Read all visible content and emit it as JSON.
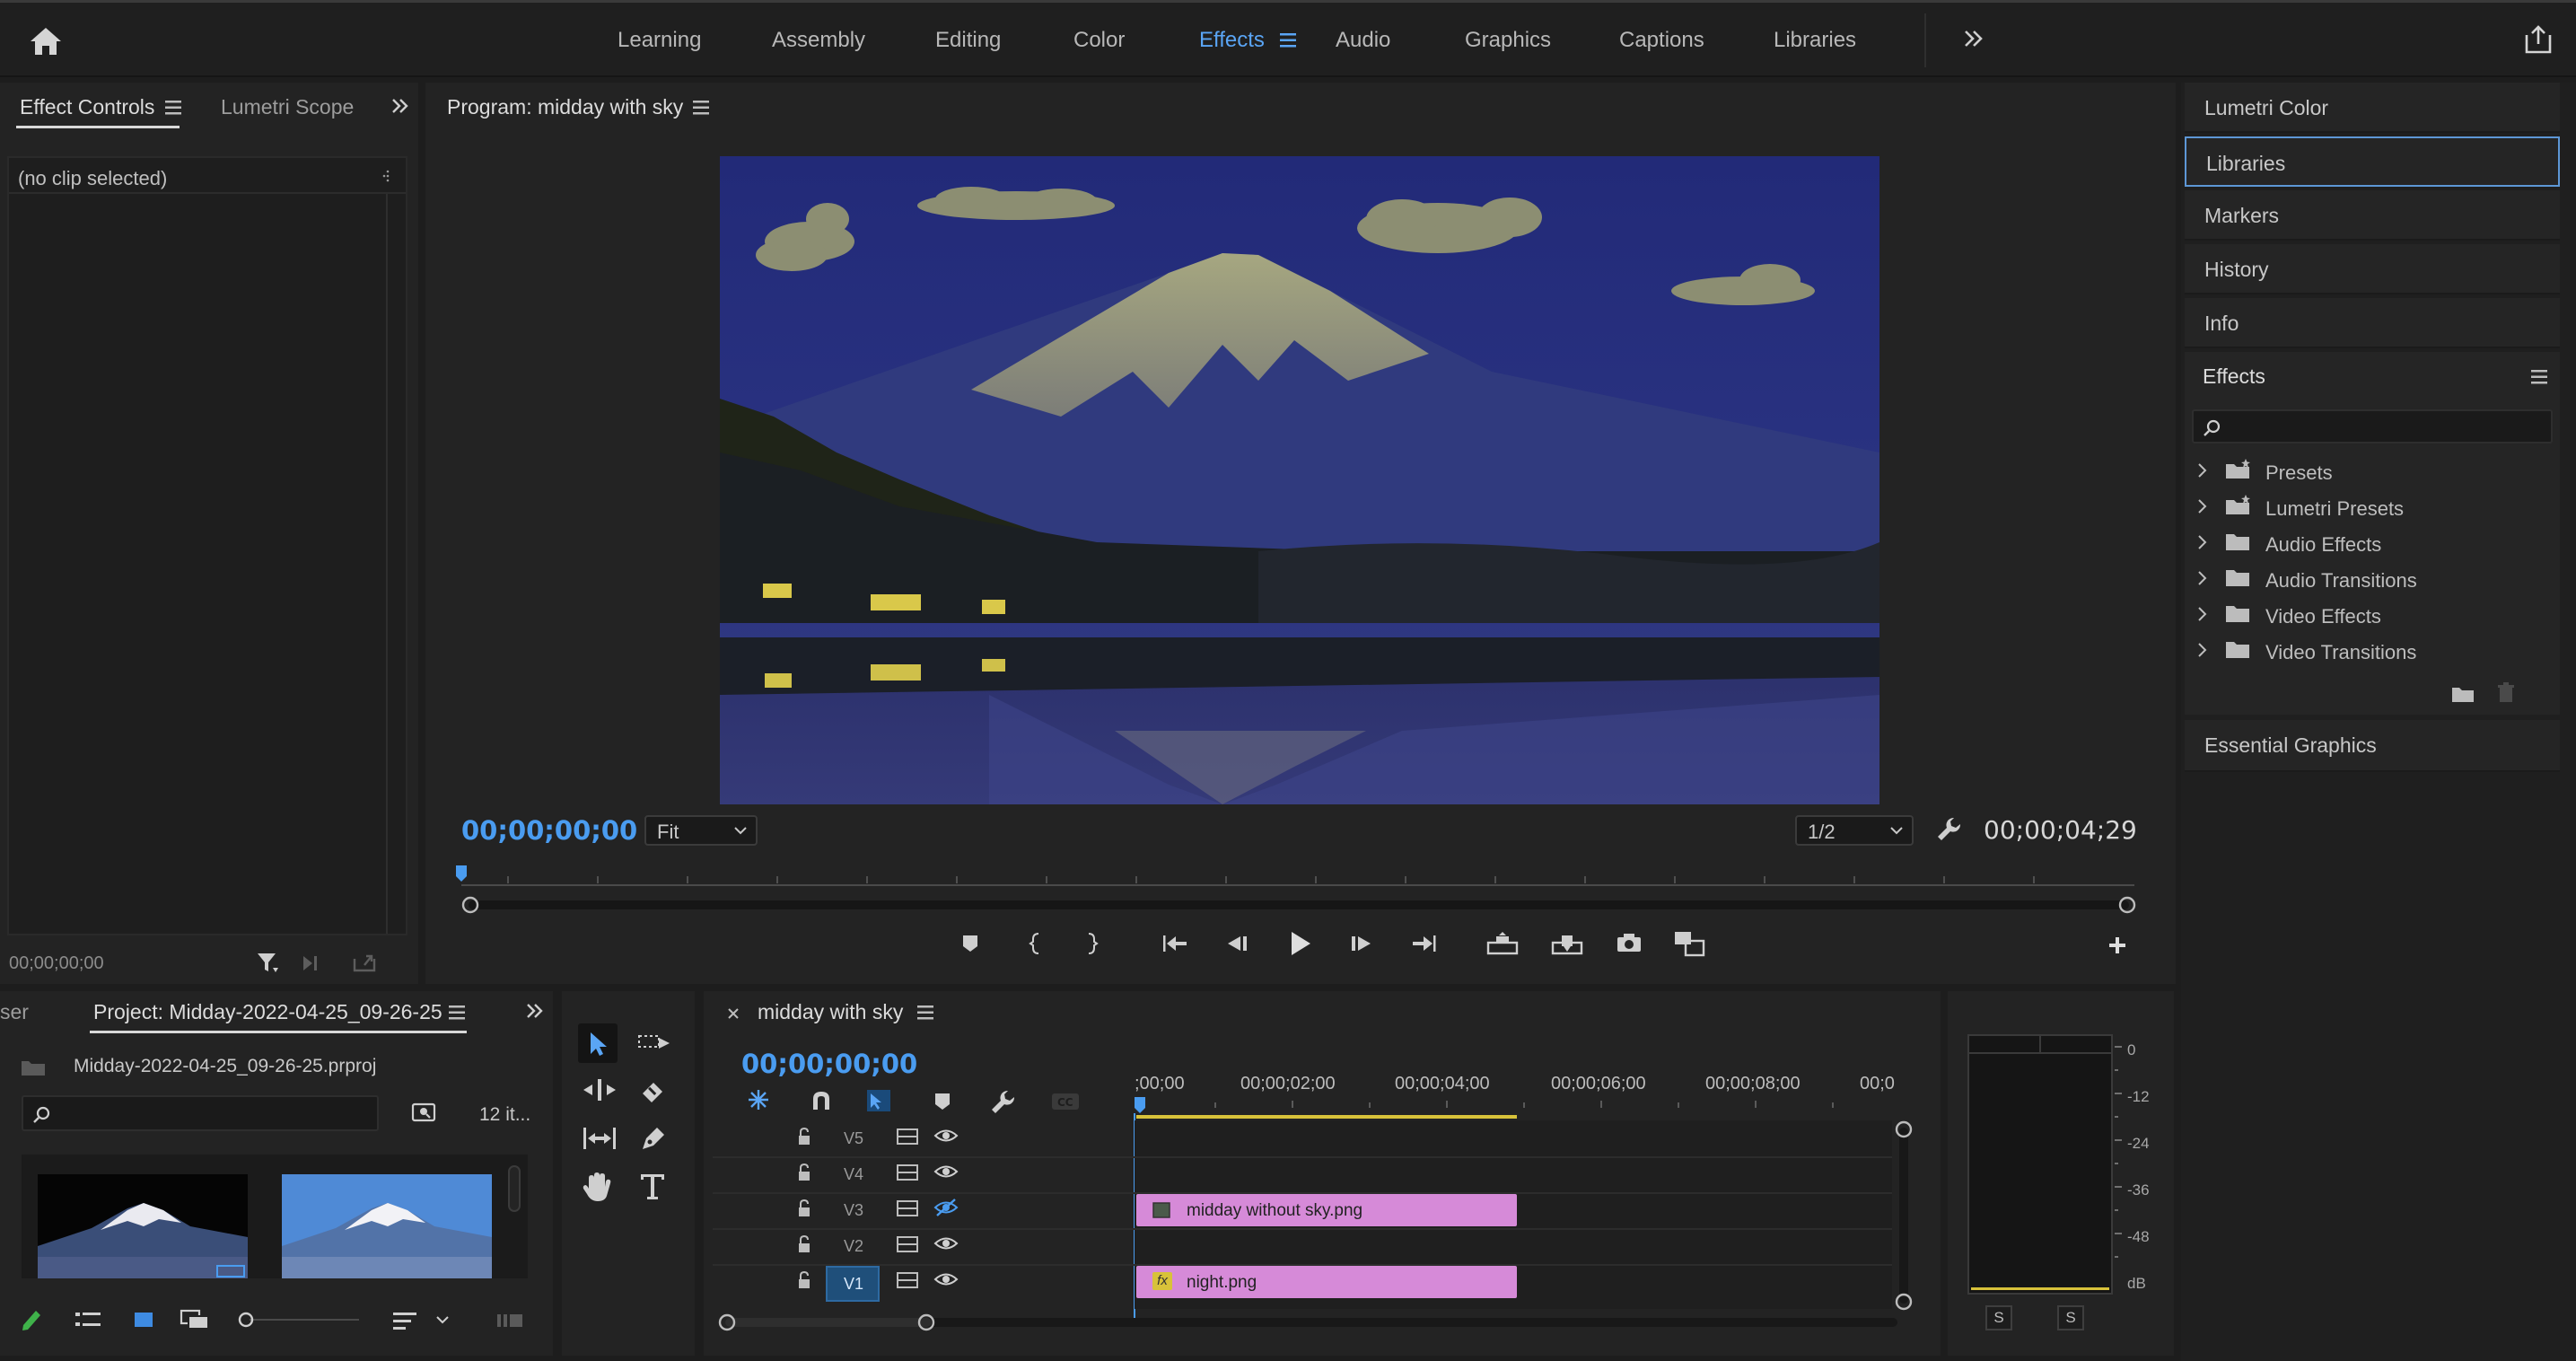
{
  "workspaces": {
    "items": [
      "Learning",
      "Assembly",
      "Editing",
      "Color",
      "Effects",
      "Audio",
      "Graphics",
      "Captions",
      "Libraries"
    ],
    "active": "Effects"
  },
  "effect_controls": {
    "tab1": "Effect Controls",
    "tab2": "Lumetri Scope",
    "no_clip": "(no clip selected)",
    "timecode": "00;00;00;00"
  },
  "program": {
    "title": "Program: midday with sky",
    "timecode_current": "00;00;00;00",
    "fit": "Fit",
    "resolution": "1/2",
    "timecode_duration": "00;00;04;29"
  },
  "project": {
    "tab_partial": "ser",
    "tab": "Project: Midday-2022-04-25_09-26-25",
    "file": "Midday-2022-04-25_09-26-25.prproj",
    "item_count": "12 it..."
  },
  "timeline": {
    "tab": "midday with sky",
    "timecode": "00;00;00;00",
    "ruler": [
      ";00;00",
      "00;00;02;00",
      "00;00;04;00",
      "00;00;06;00",
      "00;00;08;00",
      "00;0("
    ],
    "tracks": [
      "V5",
      "V4",
      "V3",
      "V2",
      "V1"
    ],
    "clips": [
      {
        "name": "midday without sky.png",
        "track": "V3"
      },
      {
        "name": "night.png",
        "track": "V1",
        "badge": "fx"
      }
    ]
  },
  "audio_meter": {
    "scale": [
      "0",
      "-12",
      "-24",
      "-36",
      "-48",
      "dB"
    ],
    "solo_left": "S",
    "solo_right": "S"
  },
  "right_panels": {
    "lumetri_color": "Lumetri Color",
    "libraries": "Libraries",
    "markers": "Markers",
    "history": "History",
    "info": "Info",
    "effects": "Effects",
    "essential_graphics": "Essential Graphics"
  },
  "effects_tree": [
    "Presets",
    "Lumetri Presets",
    "Audio Effects",
    "Audio Transitions",
    "Video Effects",
    "Video Transitions"
  ],
  "colors": {
    "accent_blue": "#4a9cf0",
    "clip_pink": "#d68ad8",
    "active_track": "#1f4f7a"
  }
}
